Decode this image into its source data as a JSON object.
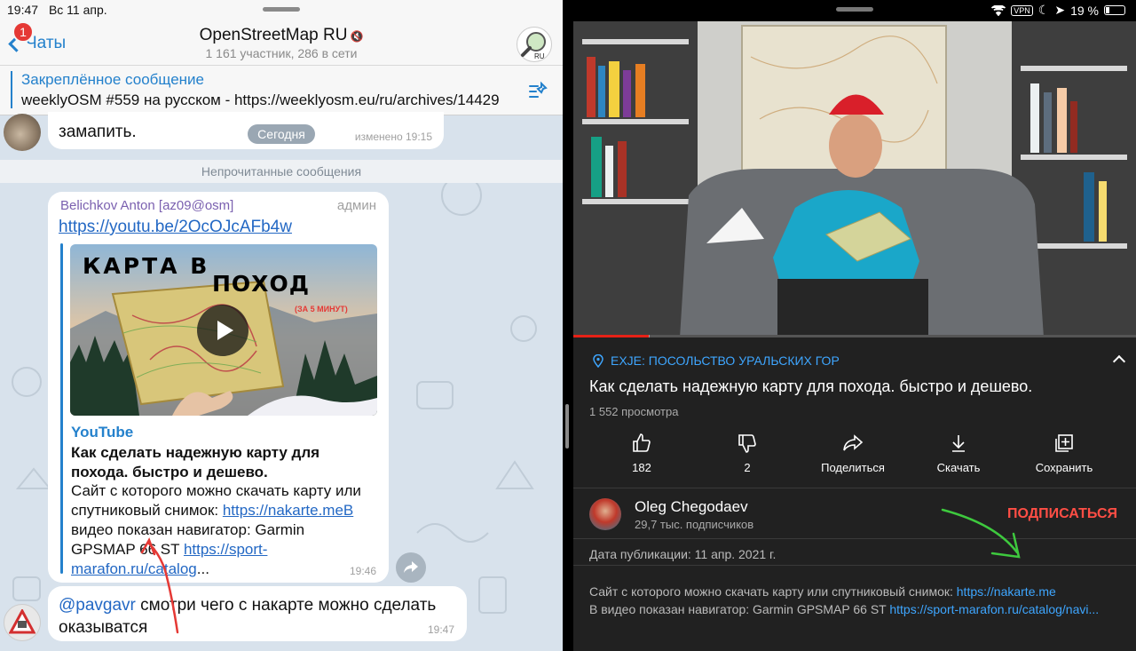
{
  "telegram": {
    "status": {
      "time": "19:47",
      "date": "Вс 11 апр."
    },
    "header": {
      "back_label": "Чаты",
      "unread_badge": "1",
      "title": "OpenStreetMap RU",
      "subtitle": "1 161 участник, 286 в сети",
      "avatar_label": "RU"
    },
    "pinned": {
      "title": "Закреплённое сообщение",
      "text": "weeklyOSM #559 на русском - https://weeklyosm.eu/ru/archives/14429"
    },
    "message1": {
      "text": "замапить.",
      "date_pill": "Сегодня",
      "time": "изменено 19:15"
    },
    "unread_separator": "Непрочитанные сообщения",
    "message2": {
      "sender": "Belichkov Anton [az09@osm]",
      "role": "админ",
      "link": "https://youtu.be/2OcOJcAFb4w",
      "thumbnail": {
        "line1": "КАРТА В",
        "line2": "ПОХОД",
        "line3": "(ЗА 5 МИНУТ)"
      },
      "preview_site": "YouTube",
      "preview_title": "Как сделать надежную карту для похода. быстро и дешево.",
      "desc_part1": "Сайт с которого можно скачать карту или спутниковый снимок: ",
      "desc_link1": "https://nakarte.meB",
      "desc_part2": " видео показан навигатор: Garmin GPSMAP 66 ST ",
      "desc_link2": "https://sport-marafon.ru/catalog",
      "desc_ellipsis": "...",
      "time": "19:46"
    },
    "message3": {
      "mention": "@pavgavr",
      "text": " смотри чего с накарте можно сделать оказыватся",
      "time": "19:47"
    }
  },
  "youtube": {
    "status": {
      "vpn": "VPN",
      "battery": "19 %"
    },
    "progress": {
      "played_fraction": 0.134,
      "buffered_fraction": 0.135
    },
    "channel_tag": "EXJE: ПОСОЛЬСТВО УРАЛЬСКИХ ГОР",
    "title": "Как сделать надежную карту для похода. быстро и дешево.",
    "views": "1 552 просмотра",
    "actions": {
      "like": "182",
      "dislike": "2",
      "share": "Поделиться",
      "download": "Скачать",
      "save": "Сохранить"
    },
    "channel": {
      "name": "Oleg Chegodaev",
      "subscribers": "29,7 тыс. подписчиков",
      "subscribe": "ПОДПИСАТЬСЯ"
    },
    "published": "Дата публикации: 11 апр. 2021 г.",
    "description": {
      "line1": "Сайт с которого можно скачать карту или спутниковый снимок: ",
      "link1": "https://nakarte.me",
      "line2": "В видео показан навигатор: Garmin GPSMAP 66 ST ",
      "link2": "https://sport-marafon.ru/catalog/navi..."
    }
  },
  "colors": {
    "telegram_link": "#2368c4",
    "youtube_link": "#3ea6ff",
    "subscribe": "#ff4e45",
    "arrow_red": "#e53935",
    "arrow_green": "#3ec93e"
  }
}
